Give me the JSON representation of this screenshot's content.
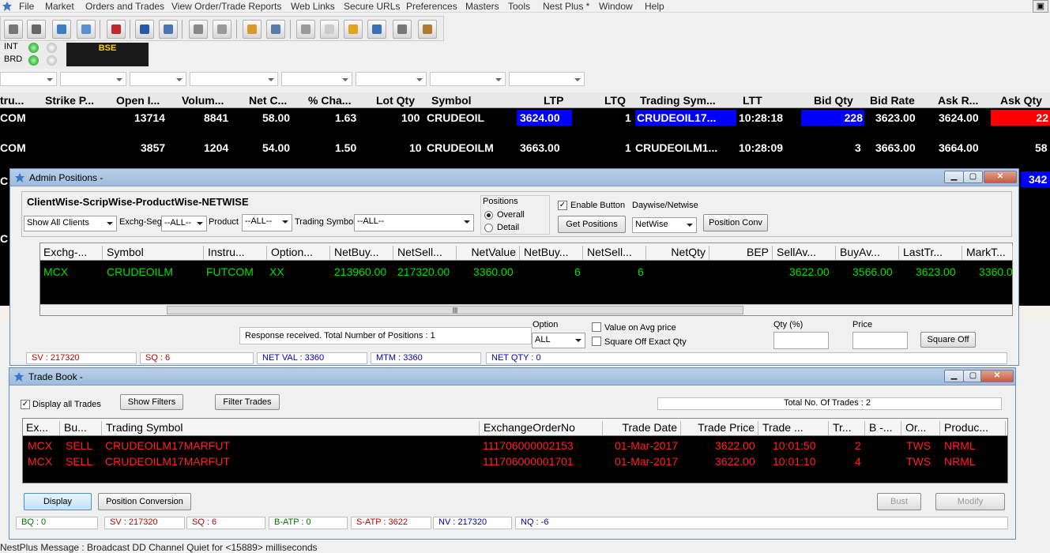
{
  "menu": [
    "File",
    "Market",
    "Orders and Trades",
    "View Order/Trade Reports",
    "Web Links",
    "Secure URLs",
    "Preferences",
    "Masters",
    "Tools",
    "Nest Plus *",
    "Window",
    "Help"
  ],
  "status": {
    "int_label": "INT",
    "brd_label": "BRD",
    "exchange": "BSE"
  },
  "market_watch": {
    "columns": [
      "tru...",
      "Strike P...",
      "Open I...",
      "Volum...",
      "Net C...",
      "% Cha...",
      "Lot Qty",
      "Symbol",
      "LTP",
      "LTQ",
      "Trading Sym...",
      "LTT",
      "Bid Qty",
      "Bid Rate",
      "Ask R...",
      "Ask Qty"
    ],
    "rows": [
      {
        "instrument": "COM",
        "strike": "",
        "oi": "13714",
        "volume": "8841",
        "net_change": "58.00",
        "pct_change": "1.63",
        "lot_qty": "100",
        "symbol": "CRUDEOIL",
        "ltp": "3624.00",
        "ltq": "1",
        "trading_symbol": "CRUDEOIL17...",
        "ltt": "10:28:18",
        "bid_qty": "228",
        "bid_rate": "3623.00",
        "ask_rate": "3624.00",
        "ask_qty": "22"
      },
      {
        "instrument": "COM",
        "strike": "",
        "oi": "3857",
        "volume": "1204",
        "net_change": "54.00",
        "pct_change": "1.50",
        "lot_qty": "10",
        "symbol": "CRUDEOILM",
        "ltp": "3663.00",
        "ltq": "1",
        "trading_symbol": "CRUDEOILM1...",
        "ltt": "10:28:09",
        "bid_qty": "3",
        "bid_rate": "3663.00",
        "ask_rate": "3664.00",
        "ask_qty": "58"
      }
    ],
    "partial_right": [
      "342",
      "C",
      "C"
    ],
    "colors": {
      "ltp_up": "#0000ff",
      "bid_up": "#0000ff",
      "ask_down": "#ff0000"
    }
  },
  "admin_positions": {
    "title": "Admin Positions -",
    "heading": "ClientWise-ScripWise-ProductWise-NETWISE",
    "clients_select": "Show All Clients",
    "exchseg_label": "Exchg-Seg",
    "exchseg_value": "--ALL--",
    "product_label": "Product",
    "product_value": "--ALL--",
    "tsym_label": "Trading Symbol",
    "tsym_value": "--ALL--",
    "positions_label": "Positions",
    "overall_label": "Overall",
    "detail_label": "Detail",
    "enable_button_label": "Enable Button",
    "daywise_label": "Daywise/Netwise",
    "get_positions": "Get Positions",
    "netwise_value": "NetWise",
    "position_conv": "Position Conv",
    "columns": [
      "Exchg-...",
      "Symbol",
      "Instru...",
      "Option...",
      "NetBuy...",
      "NetSell...",
      "NetValue",
      "NetBuy...",
      "NetSell...",
      "NetQty",
      "BEP",
      "SellAv...",
      "BuyAv...",
      "LastTr...",
      "MarkT..."
    ],
    "row": [
      "MCX",
      "CRUDEOILM",
      "FUTCOM",
      "XX",
      "213960.00",
      "217320.00",
      "3360.00",
      "6",
      "6",
      "",
      "",
      "3622.00",
      "3566.00",
      "3623.00",
      "3360.0"
    ],
    "response": "Response received. Total Number of Positions : 1",
    "option_label": "Option",
    "option_value": "ALL",
    "value_on_avg": "Value on Avg  price",
    "square_off_exact": "Square Off Exact Qty",
    "qty_label": "Qty (%)",
    "price_label": "Price",
    "square_off": "Square Off",
    "summary": [
      "SV : 217320",
      "SQ : 6",
      "NET VAL : 3360",
      "MTM : 3360",
      "NET QTY : 0"
    ]
  },
  "trade_book": {
    "title": "Trade Book -",
    "display_all": "Display all Trades",
    "show_filters": "Show Filters",
    "filter_trades": "Filter Trades",
    "total_trades": "Total No. Of Trades : 2",
    "columns": [
      "Ex...",
      "Bu...",
      "Trading Symbol",
      "ExchangeOrderNo",
      "Trade Date",
      "Trade Price",
      "Trade ...",
      "Tr...",
      "B -...",
      "Or...",
      "Produc..."
    ],
    "rows": [
      [
        "MCX",
        "SELL",
        "CRUDEOILM17MARFUT",
        "111706000002153",
        "01-Mar-2017",
        "3622.00",
        "10:01:50",
        "2",
        "",
        "TWS",
        "NRML"
      ],
      [
        "MCX",
        "SELL",
        "CRUDEOILM17MARFUT",
        "111706000001701",
        "01-Mar-2017",
        "3622.00",
        "10:01:10",
        "4",
        "",
        "TWS",
        "NRML"
      ]
    ],
    "display_btn": "Display",
    "position_conversion": "Position Conversion",
    "bust": "Bust",
    "modify": "Modify",
    "summary": [
      "BQ : 0",
      "SV : 217320",
      "SQ : 6",
      "B-ATP : 0",
      "S-ATP : 3622",
      "NV : 217320",
      "NQ : -6"
    ]
  },
  "message": "NestPlus Message : Broadcast DD Channel Quiet for  <15889> milliseconds"
}
